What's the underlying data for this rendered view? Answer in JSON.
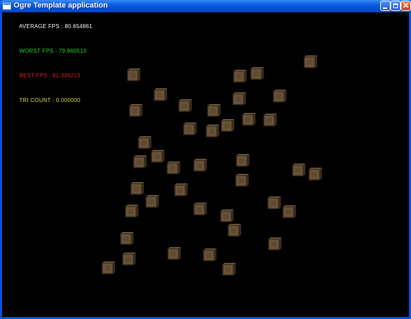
{
  "window": {
    "title": "Ogre Template application",
    "minimize_icon": "minimize-icon",
    "maximize_icon": "maximize-icon",
    "close_icon": "close-icon"
  },
  "stats": [
    {
      "label": "AVERAGE FPS",
      "value": "80.654861",
      "color": "#ffffff"
    },
    {
      "label": "WORST FPS",
      "value": "79.960510",
      "color": "#22dd22"
    },
    {
      "label": "BEST FPS",
      "value": "81.349213",
      "color": "#dd2222"
    },
    {
      "label": "TRI COUNT",
      "value": "0.000000",
      "color": "#e8d84a"
    }
  ],
  "scene": {
    "object_icon": "crate-cube",
    "crate_color": "#5e4a32"
  }
}
